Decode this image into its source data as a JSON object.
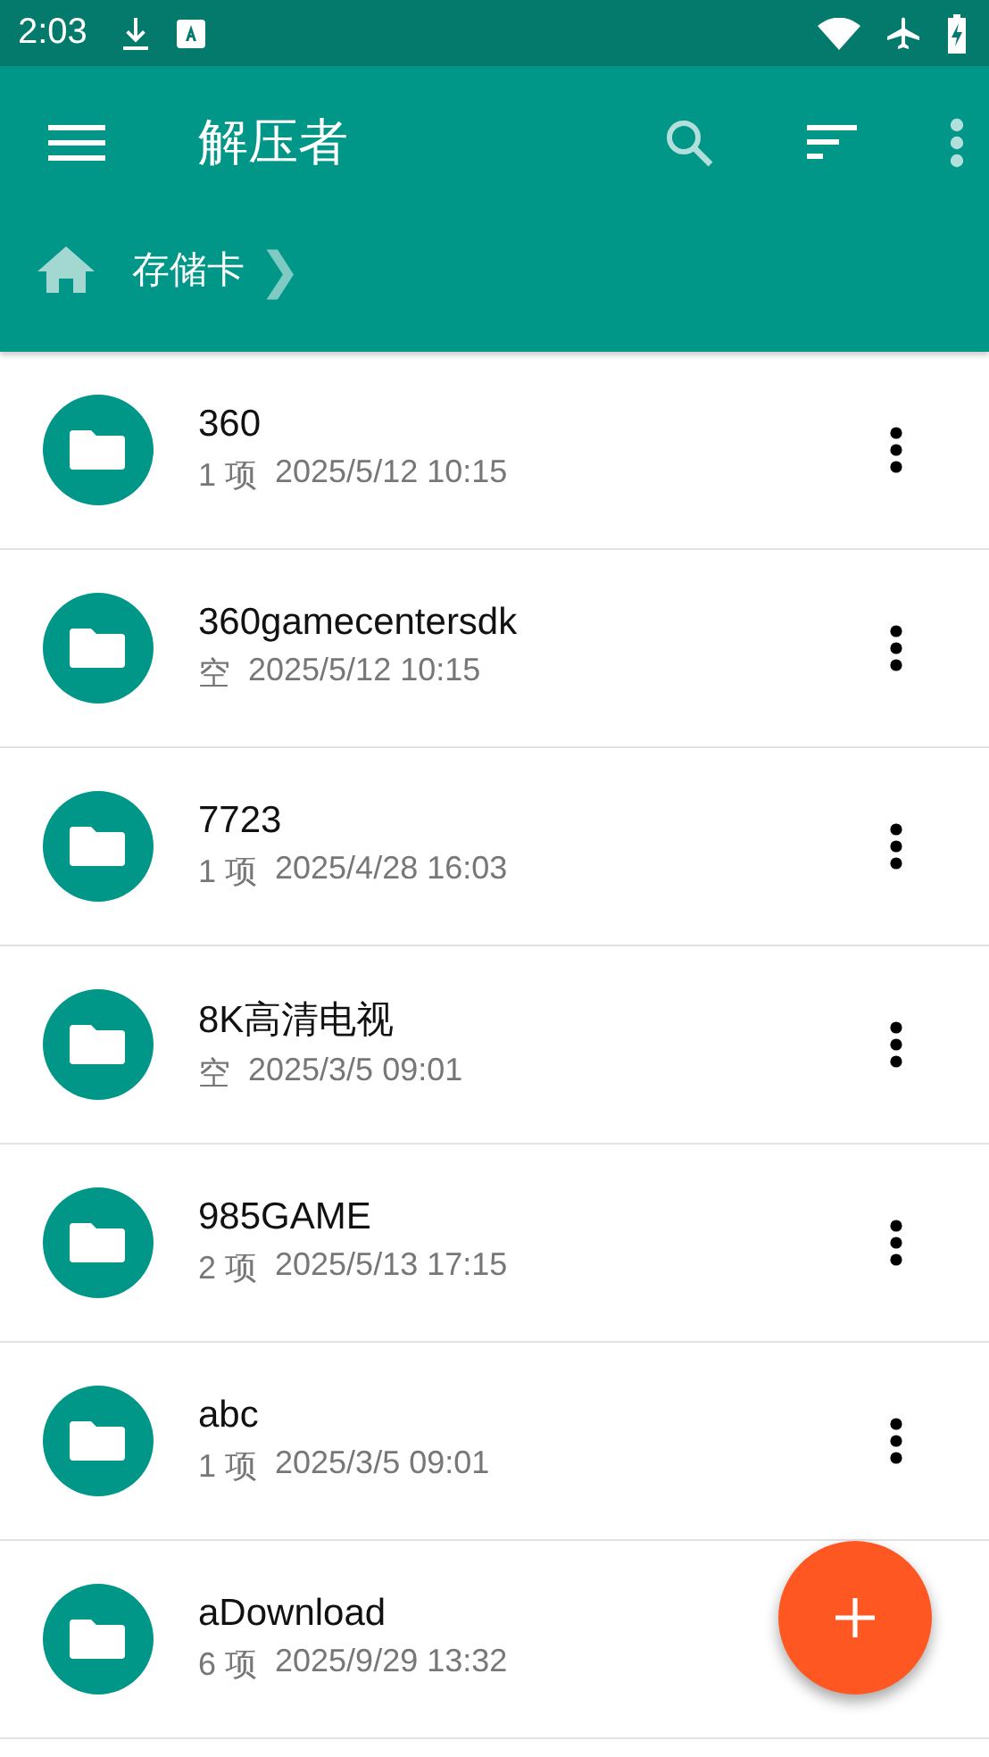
{
  "status_bar": {
    "time": "2:03"
  },
  "toolbar": {
    "title": "解压者"
  },
  "breadcrumb": {
    "items": [
      {
        "label": "存储卡"
      }
    ],
    "separator": "❯"
  },
  "files": [
    {
      "name": "360",
      "count": "1 项",
      "date": "2025/5/12 10:15"
    },
    {
      "name": "360gamecentersdk",
      "count": "空",
      "date": "2025/5/12 10:15"
    },
    {
      "name": "7723",
      "count": "1 项",
      "date": "2025/4/28 16:03"
    },
    {
      "name": "8K高清电视",
      "count": "空",
      "date": "2025/3/5 09:01"
    },
    {
      "name": "985GAME",
      "count": "2 项",
      "date": "2025/5/13 17:15"
    },
    {
      "name": "abc",
      "count": "1 项",
      "date": "2025/3/5 09:01"
    },
    {
      "name": "aDownload",
      "count": "6 项",
      "date": "2025/9/29 13:32"
    }
  ]
}
